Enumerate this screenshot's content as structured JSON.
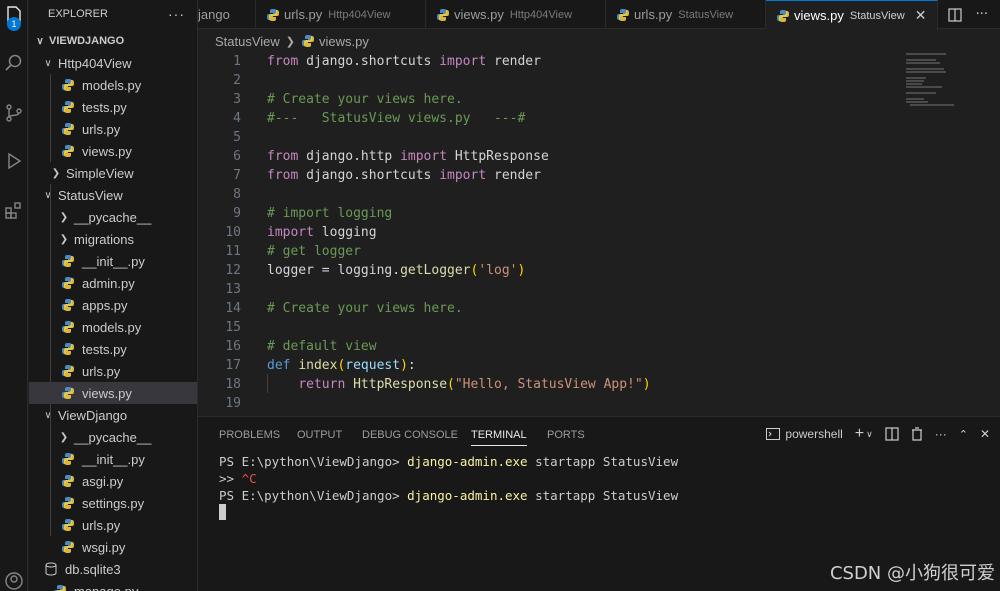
{
  "activity_bar": {
    "explorer_badge": "1",
    "icons": [
      "files-icon",
      "search-icon",
      "source-control-icon",
      "run-debug-icon",
      "extensions-icon",
      "account-icon"
    ]
  },
  "sidebar": {
    "title": "EXPLORER",
    "more": "···",
    "root": "VIEWDJANGO",
    "items": [
      {
        "label": "Http404View",
        "type": "folder-open"
      },
      {
        "label": "models.py",
        "type": "file"
      },
      {
        "label": "tests.py",
        "type": "file"
      },
      {
        "label": "urls.py",
        "type": "file"
      },
      {
        "label": "views.py",
        "type": "file"
      },
      {
        "label": "SimpleView",
        "type": "folder-closed"
      },
      {
        "label": "StatusView",
        "type": "folder-open"
      },
      {
        "label": "__pycache__",
        "type": "folder-closed"
      },
      {
        "label": "migrations",
        "type": "folder-closed"
      },
      {
        "label": "__init__.py",
        "type": "file"
      },
      {
        "label": "admin.py",
        "type": "file"
      },
      {
        "label": "apps.py",
        "type": "file"
      },
      {
        "label": "models.py",
        "type": "file"
      },
      {
        "label": "tests.py",
        "type": "file"
      },
      {
        "label": "urls.py",
        "type": "file"
      },
      {
        "label": "views.py",
        "type": "file",
        "selected": true
      },
      {
        "label": "ViewDjango",
        "type": "folder-open"
      },
      {
        "label": "__pycache__",
        "type": "folder-closed"
      },
      {
        "label": "__init__.py",
        "type": "file"
      },
      {
        "label": "asgi.py",
        "type": "file"
      },
      {
        "label": "settings.py",
        "type": "file"
      },
      {
        "label": "urls.py",
        "type": "file"
      },
      {
        "label": "wsgi.py",
        "type": "file"
      },
      {
        "label": "db.sqlite3",
        "type": "db"
      },
      {
        "label": "manage.py",
        "type": "file"
      }
    ]
  },
  "tabs": [
    {
      "name": "jango",
      "sub": ""
    },
    {
      "name": "urls.py",
      "sub": "Http404View"
    },
    {
      "name": "views.py",
      "sub": "Http404View"
    },
    {
      "name": "urls.py",
      "sub": "StatusView"
    },
    {
      "name": "views.py",
      "sub": "StatusView",
      "active": true
    }
  ],
  "breadcrumb": {
    "folder": "StatusView",
    "file": "views.py"
  },
  "editor": {
    "lines": [
      {
        "n": "1",
        "tokens": [
          [
            "kw",
            "from"
          ],
          [
            "id",
            " django.shortcuts "
          ],
          [
            "kw",
            "import"
          ],
          [
            "id",
            " render"
          ]
        ]
      },
      {
        "n": "2",
        "tokens": []
      },
      {
        "n": "3",
        "tokens": [
          [
            "cm",
            "# Create your views here."
          ]
        ]
      },
      {
        "n": "4",
        "tokens": [
          [
            "cm",
            "#---   StatusView views.py   ---#"
          ]
        ]
      },
      {
        "n": "5",
        "tokens": []
      },
      {
        "n": "6",
        "tokens": [
          [
            "kw",
            "from"
          ],
          [
            "id",
            " django.http "
          ],
          [
            "kw",
            "import"
          ],
          [
            "id",
            " HttpResponse"
          ]
        ]
      },
      {
        "n": "7",
        "tokens": [
          [
            "kw",
            "from"
          ],
          [
            "id",
            " django.shortcuts "
          ],
          [
            "kw",
            "import"
          ],
          [
            "id",
            " render"
          ]
        ]
      },
      {
        "n": "8",
        "tokens": []
      },
      {
        "n": "9",
        "tokens": [
          [
            "cm",
            "# import logging"
          ]
        ]
      },
      {
        "n": "10",
        "tokens": [
          [
            "kw",
            "import"
          ],
          [
            "id",
            " logging"
          ]
        ]
      },
      {
        "n": "11",
        "tokens": [
          [
            "cm",
            "# get logger"
          ]
        ]
      },
      {
        "n": "12",
        "tokens": [
          [
            "id",
            "logger = logging."
          ],
          [
            "fn",
            "getLogger"
          ],
          [
            "pr",
            "("
          ],
          [
            "str",
            "'log'"
          ],
          [
            "pr",
            ")"
          ]
        ]
      },
      {
        "n": "13",
        "tokens": []
      },
      {
        "n": "14",
        "tokens": [
          [
            "cm",
            "# Create your views here."
          ]
        ]
      },
      {
        "n": "15",
        "tokens": []
      },
      {
        "n": "16",
        "tokens": [
          [
            "cm",
            "# default view"
          ]
        ]
      },
      {
        "n": "17",
        "tokens": [
          [
            "kwb",
            "def"
          ],
          [
            "id",
            " "
          ],
          [
            "fn",
            "index"
          ],
          [
            "pr",
            "("
          ],
          [
            "param",
            "request"
          ],
          [
            "pr",
            ")"
          ],
          [
            "id",
            ":"
          ]
        ]
      },
      {
        "n": "18",
        "tokens": [
          [
            "id",
            "    "
          ],
          [
            "kw",
            "return"
          ],
          [
            "id",
            " "
          ],
          [
            "fn",
            "HttpResponse"
          ],
          [
            "pr",
            "("
          ],
          [
            "str",
            "\"Hello, StatusView App!\""
          ],
          [
            "pr",
            ")"
          ]
        ]
      },
      {
        "n": "19",
        "tokens": []
      }
    ]
  },
  "panel": {
    "tabs": [
      "PROBLEMS",
      "OUTPUT",
      "DEBUG CONSOLE",
      "TERMINAL",
      "PORTS"
    ],
    "active_tab": "TERMINAL",
    "shell": "powershell",
    "terminal": [
      {
        "prompt": "PS E:\\python\\ViewDjango> ",
        "cmd": "django-admin.exe",
        "args": " startapp StatusView"
      },
      {
        "prompt": ">> ",
        "ctl": "^C"
      },
      {
        "prompt": "PS E:\\python\\ViewDjango> ",
        "cmd": "django-admin.exe",
        "args": " startapp StatusView"
      }
    ]
  },
  "watermark": "CSDN @小狗很可爱",
  "colors": {
    "accent": "#0078d4",
    "python_icon": "#4b8bbe",
    "selected_row": "#37373d"
  }
}
